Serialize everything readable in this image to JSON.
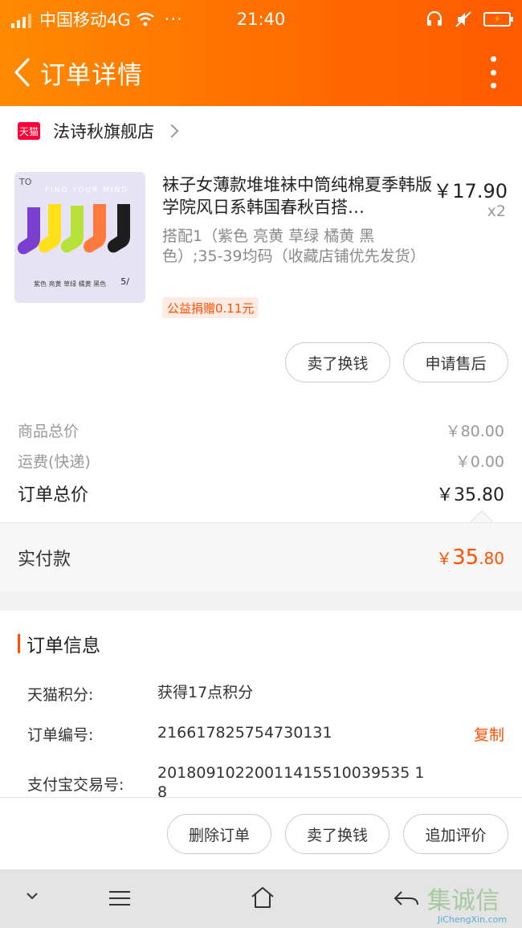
{
  "status_bar": {
    "carrier": "中国移动4G",
    "dots": "···",
    "time": "21:40"
  },
  "nav": {
    "title": "订单详情"
  },
  "store": {
    "badge": "天猫",
    "name": "法诗秋旗舰店"
  },
  "product": {
    "title": "袜子女薄款堆堆袜中筒纯棉夏季韩版学院风日系韩国春秋百搭…",
    "price": "￥17.90",
    "quantity": "x2",
    "spec": "搭配1（紫色 亮黄 草绿 橘黄 黑色）;35-39均码（收藏店铺优先发货）",
    "charity_tag": "公益捐赠0.11元",
    "image": {
      "brand": "TO",
      "slogan": "FIND YOUR MIND",
      "colors": "紫色  亮黄  草绿  橘黄  黑色",
      "count": "5/"
    },
    "actions": {
      "sell": "卖了换钱",
      "after_sale": "申请售后"
    }
  },
  "summary": {
    "goods_total_label": "商品总价",
    "goods_total_value": "￥80.00",
    "shipping_label": "运费(快递)",
    "shipping_value": "￥0.00",
    "order_total_label": "订单总价",
    "order_total_value": "￥35.80"
  },
  "paid": {
    "label": "实付款",
    "currency": "￥",
    "integer": "35",
    "decimal": ".80"
  },
  "order_info": {
    "title": "订单信息",
    "points_label": "天猫积分:",
    "points_value": "获得17点积分",
    "order_no_label": "订单编号:",
    "order_no_value": "216617825754730131",
    "copy": "复制",
    "alipay_label": "支付宝交易号:",
    "alipay_value": "20180910220011415510039535 18"
  },
  "footer": {
    "delete": "删除订单",
    "sell": "卖了换钱",
    "review": "追加评价"
  },
  "watermark": {
    "text": "集诚信",
    "url": "JiChengXin.com"
  },
  "colors": {
    "brand_orange": "#ff6a00",
    "accent_red": "#ff5000",
    "tmall_red": "#ff0036"
  }
}
